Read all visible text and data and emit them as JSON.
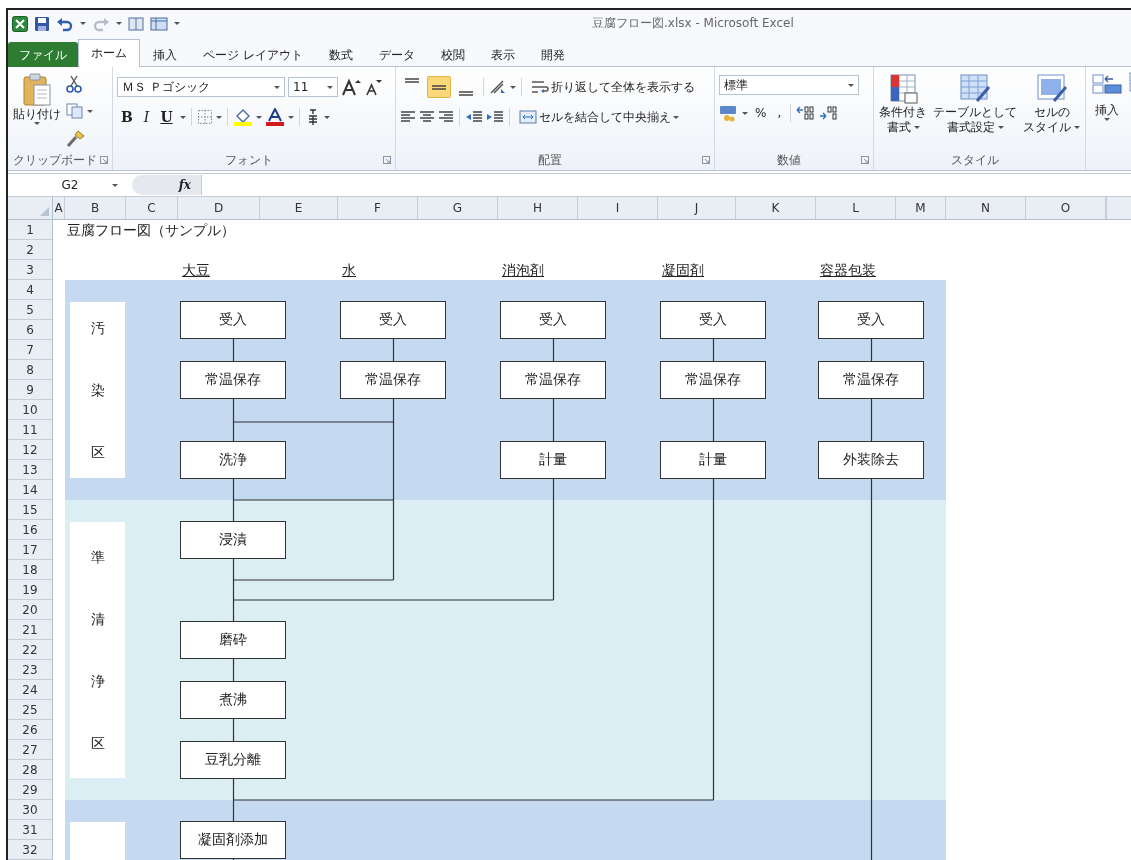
{
  "window": {
    "title": "豆腐フロー図.xlsx - Microsoft Excel"
  },
  "tabs": [
    {
      "label": "ファイル",
      "kind": "file",
      "selected": false
    },
    {
      "label": "ホーム",
      "kind": "tab",
      "selected": true
    },
    {
      "label": "挿入",
      "kind": "tab",
      "selected": false
    },
    {
      "label": "ページ レイアウト",
      "kind": "tab",
      "selected": false
    },
    {
      "label": "数式",
      "kind": "tab",
      "selected": false
    },
    {
      "label": "データ",
      "kind": "tab",
      "selected": false
    },
    {
      "label": "校閲",
      "kind": "tab",
      "selected": false
    },
    {
      "label": "表示",
      "kind": "tab",
      "selected": false
    },
    {
      "label": "開発",
      "kind": "tab",
      "selected": false
    }
  ],
  "ribbon": {
    "clipboard": {
      "paste": "貼り付け",
      "label": "クリップボード"
    },
    "font": {
      "name": "ＭＳ Ｐゴシック",
      "size": "11",
      "bold": "B",
      "italic": "I",
      "underline": "U",
      "label": "フォント"
    },
    "alignment": {
      "vertical_align": [
        {
          "selected": false
        },
        {
          "selected": true
        },
        {
          "selected": false
        }
      ],
      "wrap": "折り返して全体を表示する",
      "merge": "セルを結合して中央揃え",
      "label": "配置"
    },
    "number": {
      "format": "標準",
      "percent": "%",
      "comma": ",",
      "label": "数値"
    },
    "styles": {
      "buttons": [
        {
          "lines": [
            "条件付き",
            "書式"
          ]
        },
        {
          "lines": [
            "テーブルとして",
            "書式設定"
          ]
        },
        {
          "lines": [
            "セルの",
            "スタイル"
          ]
        }
      ],
      "label": "スタイル"
    },
    "cells": {
      "insert": "挿入"
    }
  },
  "formula_bar": {
    "name_box": "G2",
    "fx": "fx"
  },
  "columns": [
    "A",
    "B",
    "C",
    "D",
    "E",
    "F",
    "G",
    "H",
    "I",
    "J",
    "K",
    "L",
    "M",
    "N",
    "O"
  ],
  "rows": [
    "1",
    "2",
    "3",
    "4",
    "5",
    "6",
    "7",
    "8",
    "9",
    "10",
    "11",
    "12",
    "13",
    "14",
    "15",
    "16",
    "17",
    "18",
    "19",
    "20",
    "21",
    "22",
    "23",
    "24",
    "25",
    "26",
    "27",
    "28",
    "29",
    "30",
    "31",
    "32"
  ],
  "sheet": {
    "title": "豆腐フロー図（サンプル）",
    "zones": [
      {
        "label": "汚染区",
        "color": "#c5d9f1"
      },
      {
        "label": "準清浄区",
        "color": "#daeef3"
      },
      {
        "color": "#c5d9f1"
      }
    ],
    "lanes": [
      {
        "header": "大豆",
        "nodes": [
          "受入",
          "常温保存",
          "洗浄",
          "浸漬",
          "磨砕",
          "煮沸",
          "豆乳分離",
          "凝固剤添加"
        ]
      },
      {
        "header": "水",
        "nodes": [
          "受入",
          "常温保存"
        ]
      },
      {
        "header": "消泡剤",
        "nodes": [
          "受入",
          "常温保存",
          "計量"
        ]
      },
      {
        "header": "凝固剤",
        "nodes": [
          "受入",
          "常温保存",
          "計量"
        ]
      },
      {
        "header": "容器包装",
        "nodes": [
          "受入",
          "常温保存",
          "外装除去"
        ]
      }
    ]
  }
}
